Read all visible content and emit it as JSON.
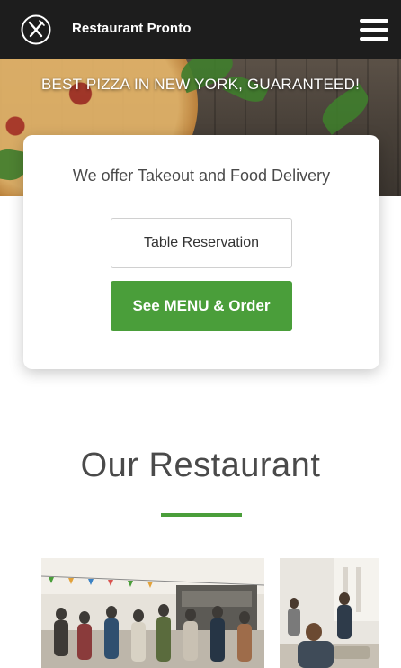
{
  "header": {
    "brand": "Restaurant Pronto",
    "logo_icon": "fork-knife-icon",
    "menu_icon": "hamburger-menu-icon"
  },
  "hero": {
    "title": "BEST PIZZA IN NEW YORK, GUARANTEED!"
  },
  "card": {
    "text": "We offer Takeout and Food Delivery",
    "reservation_label": "Table Reservation",
    "menu_order_label": "See MENU & Order"
  },
  "section": {
    "title": "Our Restaurant"
  },
  "colors": {
    "header_bg": "#1d1d1d",
    "accent_green": "#4a9e3a",
    "text_dark": "#4a4a4a"
  }
}
